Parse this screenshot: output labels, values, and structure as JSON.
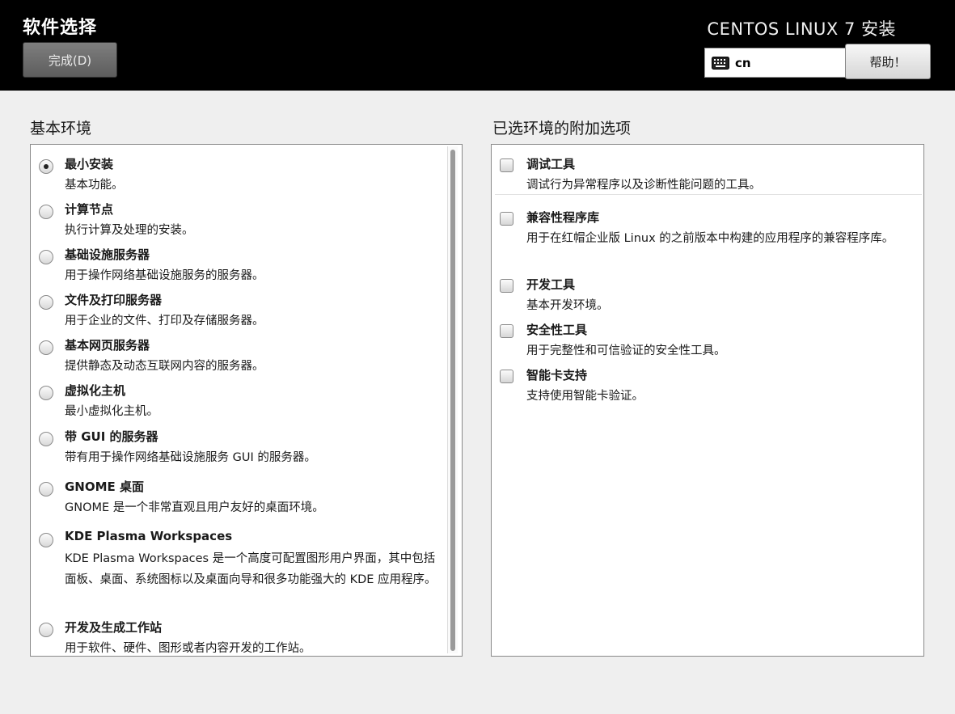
{
  "header": {
    "title": "软件选择",
    "done_label": "完成(D)",
    "install_title": "CENTOS LINUX 7 安装",
    "keyboard_layout": "cn",
    "help_label": "帮助！"
  },
  "base_environment": {
    "title": "基本环境",
    "items": [
      {
        "name": "最小安装",
        "desc": "基本功能。",
        "selected": true
      },
      {
        "name": "计算节点",
        "desc": "执行计算及处理的安装。",
        "selected": false
      },
      {
        "name": "基础设施服务器",
        "desc": "用于操作网络基础设施服务的服务器。",
        "selected": false
      },
      {
        "name": "文件及打印服务器",
        "desc": "用于企业的文件、打印及存储服务器。",
        "selected": false
      },
      {
        "name": "基本网页服务器",
        "desc": "提供静态及动态互联网内容的服务器。",
        "selected": false
      },
      {
        "name": "虚拟化主机",
        "desc": "最小虚拟化主机。",
        "selected": false
      },
      {
        "name": "带 GUI 的服务器",
        "desc": "带有用于操作网络基础设施服务 GUI 的服务器。",
        "selected": false
      },
      {
        "name": "GNOME 桌面",
        "desc": "GNOME 是一个非常直观且用户友好的桌面环境。",
        "selected": false
      },
      {
        "name": "KDE Plasma Workspaces",
        "desc": "KDE Plasma Workspaces 是一个高度可配置图形用户界面，其中包括面板、桌面、系统图标以及桌面向导和很多功能强大的 KDE 应用程序。",
        "selected": false
      },
      {
        "name": "开发及生成工作站",
        "desc": "用于软件、硬件、图形或者内容开发的工作站。",
        "selected": false
      }
    ]
  },
  "addons": {
    "title": "已选环境的附加选项",
    "items": [
      {
        "name": "调试工具",
        "desc": "调试行为异常程序以及诊断性能问题的工具。",
        "checked": false
      },
      {
        "name": "兼容性程序库",
        "desc": "用于在红帽企业版 Linux 的之前版本中构建的应用程序的兼容程序库。",
        "checked": false
      },
      {
        "name": "开发工具",
        "desc": "基本开发环境。",
        "checked": false
      },
      {
        "name": "安全性工具",
        "desc": "用于完整性和可信验证的安全性工具。",
        "checked": false
      },
      {
        "name": "智能卡支持",
        "desc": "支持使用智能卡验证。",
        "checked": false
      }
    ]
  }
}
